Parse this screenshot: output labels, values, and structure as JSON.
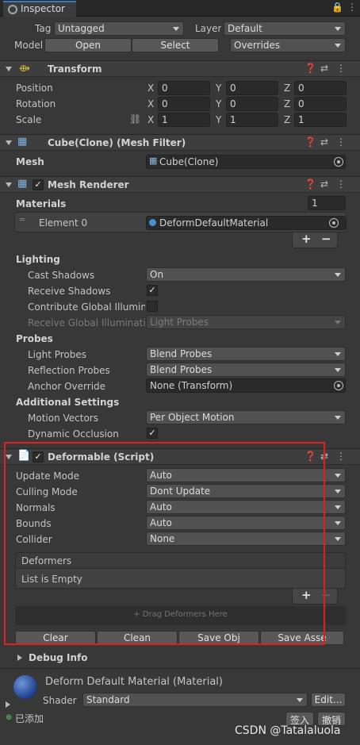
{
  "window": {
    "tab_title": "Inspector"
  },
  "object_header": {
    "tag_label": "Tag",
    "tag_value": "Untagged",
    "layer_label": "Layer",
    "layer_value": "Default",
    "model_label": "Model",
    "open_label": "Open",
    "select_label": "Select",
    "overrides_label": "Overrides"
  },
  "transform": {
    "title": "Transform",
    "position_label": "Position",
    "rotation_label": "Rotation",
    "scale_label": "Scale",
    "axis_x": "X",
    "axis_y": "Y",
    "axis_z": "Z",
    "position": {
      "x": "0",
      "y": "0",
      "z": "0"
    },
    "rotation": {
      "x": "0",
      "y": "0",
      "z": "0"
    },
    "scale": {
      "x": "1",
      "y": "1",
      "z": "1"
    }
  },
  "mesh_filter": {
    "title": "Cube(Clone) (Mesh Filter)",
    "mesh_label": "Mesh",
    "mesh_value": "Cube(Clone)"
  },
  "mesh_renderer": {
    "title": "Mesh Renderer",
    "materials_label": "Materials",
    "materials_count": "1",
    "element0_label": "Element 0",
    "element0_value": "DeformDefaultMaterial",
    "lighting_label": "Lighting",
    "cast_shadows_label": "Cast Shadows",
    "cast_shadows_value": "On",
    "receive_shadows_label": "Receive Shadows",
    "contribute_gi_label": "Contribute Global Illuminat",
    "receive_gi_label": "Receive Global Illumination",
    "receive_gi_value": "Light Probes",
    "probes_label": "Probes",
    "light_probes_label": "Light Probes",
    "light_probes_value": "Blend Probes",
    "reflection_probes_label": "Reflection Probes",
    "reflection_probes_value": "Blend Probes",
    "anchor_override_label": "Anchor Override",
    "anchor_override_value": "None (Transform)",
    "additional_label": "Additional Settings",
    "motion_vectors_label": "Motion Vectors",
    "motion_vectors_value": "Per Object Motion",
    "dynamic_occlusion_label": "Dynamic Occlusion"
  },
  "deformable": {
    "title": "Deformable (Script)",
    "update_mode_label": "Update Mode",
    "update_mode_value": "Auto",
    "culling_mode_label": "Culling Mode",
    "culling_mode_value": "Dont Update",
    "normals_label": "Normals",
    "normals_value": "Auto",
    "bounds_label": "Bounds",
    "bounds_value": "Auto",
    "collider_label": "Collider",
    "collider_value": "None",
    "deformers_label": "Deformers",
    "list_empty_label": "List is Empty",
    "drag_hint": "+ Drag Deformers Here",
    "clear_label": "Clear",
    "clean_label": "Clean",
    "save_obj_label": "Save Obj",
    "save_asset_label": "Save Asse",
    "debug_info_label": "Debug Info"
  },
  "material": {
    "title": "Deform Default Material (Material)",
    "shader_label": "Shader",
    "shader_value": "Standard",
    "edit_label": "Edit..."
  },
  "footer": {
    "status_label": "已添加",
    "sign_in_label": "签入",
    "undo_label": "撤销"
  },
  "watermark": "CSDN @Tatalaluola",
  "colors": {
    "highlight_box": "#e02020",
    "tab_accent": "#3a79bb"
  }
}
